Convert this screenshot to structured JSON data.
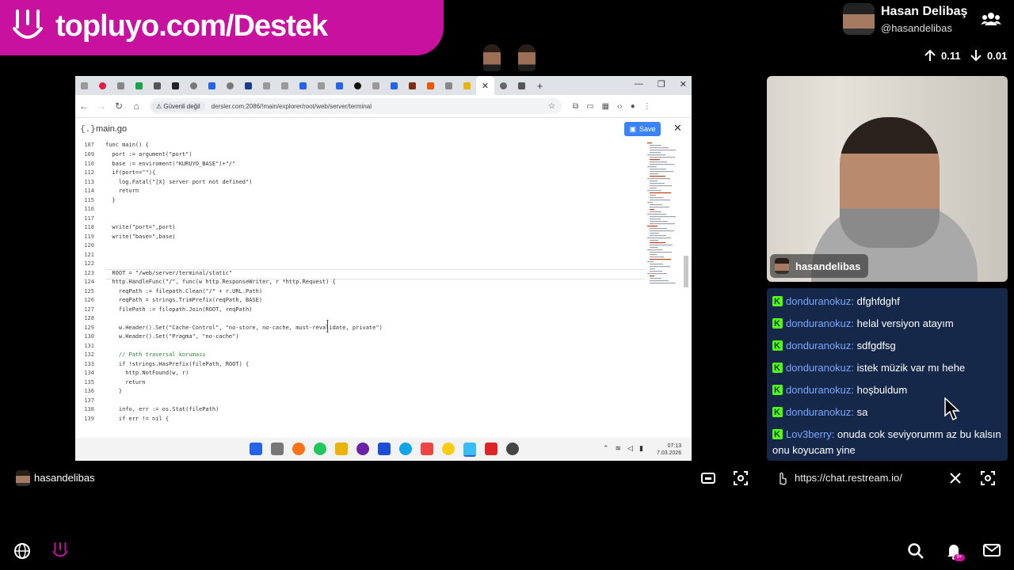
{
  "banner": {
    "text": "topluyo.com/Destek"
  },
  "profile": {
    "name": "Hasan Delibaş",
    "handle": "@hasandelibas",
    "upload": "0.11",
    "download": "0.01"
  },
  "browser": {
    "security_label": "Güvenli değil",
    "url": "dersler.com:2086/!main/explorer/root/web/server/terminal",
    "filename": "main.go",
    "save_label": "Save",
    "clock_time": "07:13",
    "clock_date": "7.03.2026"
  },
  "code_lines": [
    {
      "n": "107",
      "t": "func main() {"
    },
    {
      "n": "109",
      "t": "  port := argument(\"port\")"
    },
    {
      "n": "110",
      "t": "  base := enviroment(\"KURUYO_BASE\")+\"/\""
    },
    {
      "n": "112",
      "t": "  if(port==\"\"){"
    },
    {
      "n": "113",
      "t": "    log.Fatal(\"[X] server port not defined\")"
    },
    {
      "n": "114",
      "t": "    return"
    },
    {
      "n": "115",
      "t": "  }"
    },
    {
      "n": "116",
      "t": ""
    },
    {
      "n": "117",
      "t": ""
    },
    {
      "n": "118",
      "t": "  write(\"port=\",port)"
    },
    {
      "n": "119",
      "t": "  write(\"base=\",base)"
    },
    {
      "n": "120",
      "t": ""
    },
    {
      "n": "121",
      "t": ""
    },
    {
      "n": "122",
      "t": ""
    },
    {
      "n": "123",
      "t": "  ROOT = \"/web/server/terminal/static\""
    },
    {
      "n": "124",
      "t": "  http.HandleFunc(\"/\", func(w http.ResponseWriter, r *http.Request) {"
    },
    {
      "n": "125",
      "t": "    reqPath := filepath.Clean(\"/\" + r.URL.Path)"
    },
    {
      "n": "126",
      "t": "    reqPath = strings.TrimPrefix(reqPath, BASE)"
    },
    {
      "n": "127",
      "t": "    filePath := filepath.Join(ROOT, reqPath)"
    },
    {
      "n": "128",
      "t": ""
    },
    {
      "n": "129",
      "t": "    w.Header().Set(\"Cache-Control\", \"no-store, no-cache, must-revalidate, private\")"
    },
    {
      "n": "130",
      "t": "    w.Header().Set(\"Pragma\", \"no-cache\")"
    },
    {
      "n": "131",
      "t": ""
    },
    {
      "n": "132",
      "t": "    // Path traversal koruması"
    },
    {
      "n": "133",
      "t": "    if !strings.HasPrefix(filePath, ROOT) {"
    },
    {
      "n": "134",
      "t": "      http.NotFound(w, r)"
    },
    {
      "n": "135",
      "t": "      return"
    },
    {
      "n": "136",
      "t": "    }"
    },
    {
      "n": "137",
      "t": ""
    },
    {
      "n": "138",
      "t": "    info, err := os.Stat(filePath)"
    },
    {
      "n": "139",
      "t": "    if err != nil {"
    }
  ],
  "webcam": {
    "name": "hasandelibas"
  },
  "chat": [
    {
      "user": "donduranokuz:",
      "text": "dfghfdghf"
    },
    {
      "user": "donduranokuz:",
      "text": "helal versiyon atayım"
    },
    {
      "user": "donduranokuz:",
      "text": "sdfgdfsg"
    },
    {
      "user": "donduranokuz:",
      "text": "istek müzik var mı hehe"
    },
    {
      "user": "donduranokuz:",
      "text": "hoşbuldum"
    },
    {
      "user": "donduranokuz:",
      "text": "sa"
    },
    {
      "user": "Lov3berry:",
      "text": "onuda cok seviyorumm az bu kalsın onu koyucam yine"
    }
  ],
  "bottom": {
    "stream_name": "hasandelibas",
    "chat_url": "https://chat.restream.io/",
    "badge": "9+"
  },
  "colors": {
    "brand": "#c8119f",
    "chat_bg": "#15284a",
    "chat_user": "#7aa7ff",
    "kick": "#53fc18",
    "save": "#3b82f6"
  }
}
